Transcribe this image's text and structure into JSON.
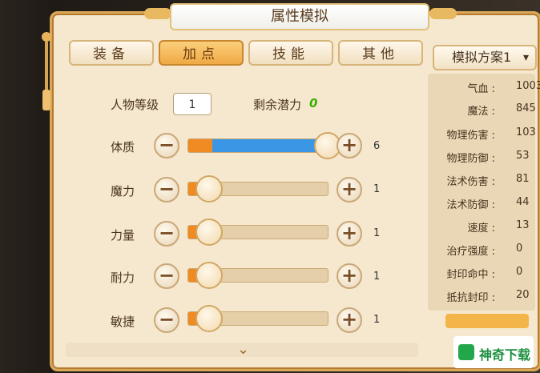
{
  "window": {
    "title": "属性模拟"
  },
  "tabs": [
    {
      "label": "装备",
      "active": false
    },
    {
      "label": "加点",
      "active": true
    },
    {
      "label": "技能",
      "active": false
    },
    {
      "label": "其他",
      "active": false
    }
  ],
  "level": {
    "label": "人物等级",
    "value": "1"
  },
  "potential": {
    "label": "剩余潜力",
    "value": "0"
  },
  "attributes": [
    {
      "label": "体质",
      "value": "6",
      "fill": 1.0
    },
    {
      "label": "魔力",
      "value": "1",
      "fill": 0.0
    },
    {
      "label": "力量",
      "value": "1",
      "fill": 0.0
    },
    {
      "label": "耐力",
      "value": "1",
      "fill": 0.0
    },
    {
      "label": "敏捷",
      "value": "1",
      "fill": 0.0
    }
  ],
  "scheme": {
    "label": "模拟方案1",
    "icon": "chevron-down-icon"
  },
  "stats": [
    {
      "label": "气血 :",
      "value": "1003"
    },
    {
      "label": "魔法 :",
      "value": "845"
    },
    {
      "label": "物理伤害 :",
      "value": "103"
    },
    {
      "label": "物理防御 :",
      "value": "53"
    },
    {
      "label": "法术伤害 :",
      "value": "81"
    },
    {
      "label": "法术防御 :",
      "value": "44"
    },
    {
      "label": "速度 :",
      "value": "13"
    },
    {
      "label": "治疗强度 :",
      "value": "0"
    },
    {
      "label": "封印命中 :",
      "value": "0"
    },
    {
      "label": "抵抗封印 :",
      "value": "20"
    }
  ],
  "watermark": {
    "text": "神奇下载"
  },
  "colors": {
    "accent": "#f0a945",
    "potential": "#38b000",
    "slider_active": "#3b97e6"
  }
}
